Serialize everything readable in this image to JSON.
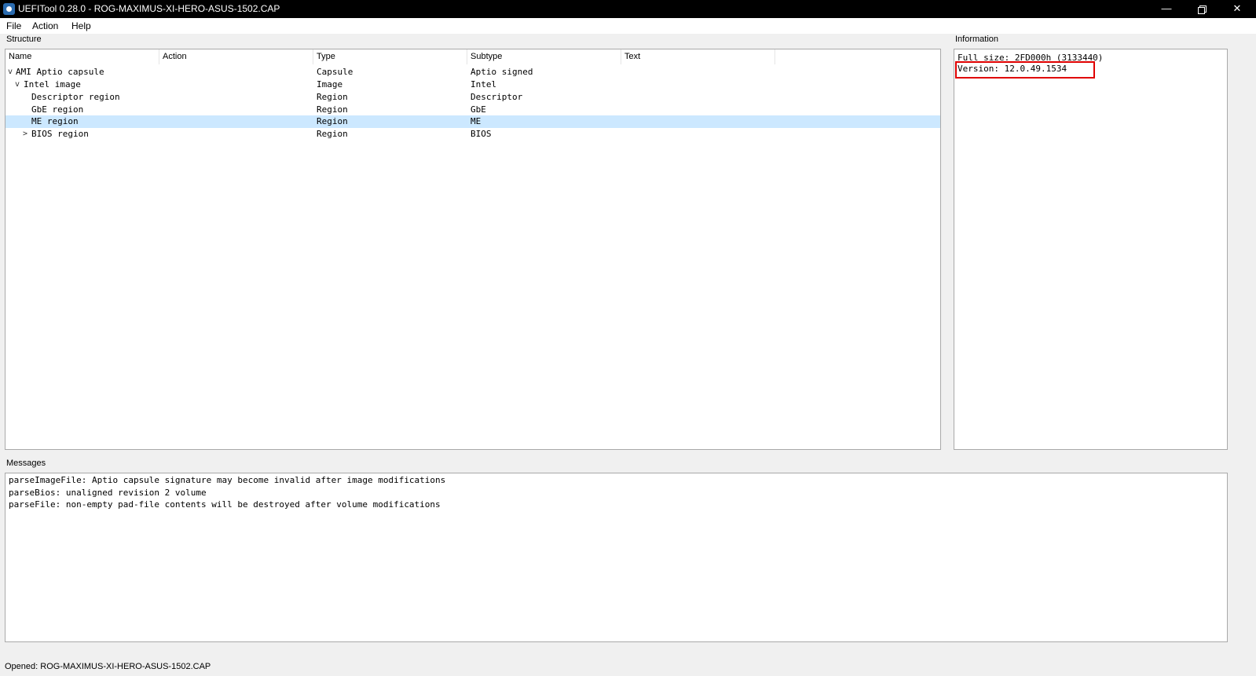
{
  "window": {
    "title": "UEFITool 0.28.0 - ROG-MAXIMUS-XI-HERO-ASUS-1502.CAP",
    "icon": "uefitool-app-icon",
    "buttons": {
      "minimize": "—",
      "close": "✕"
    }
  },
  "menu": {
    "file": "File",
    "action": "Action",
    "help": "Help"
  },
  "structure": {
    "label": "Structure",
    "columns": [
      "Name",
      "Action",
      "Type",
      "Subtype",
      "Text"
    ],
    "rows": [
      {
        "name": "AMI Aptio capsule",
        "action": "",
        "type": "Capsule",
        "subtype": "Aptio signed",
        "text": "",
        "expander": "v"
      },
      {
        "name": "Intel image",
        "action": "",
        "type": "Image",
        "subtype": "Intel",
        "text": "",
        "expander": "v"
      },
      {
        "name": "Descriptor region",
        "action": "",
        "type": "Region",
        "subtype": "Descriptor",
        "text": "",
        "expander": ""
      },
      {
        "name": "GbE region",
        "action": "",
        "type": "Region",
        "subtype": "GbE",
        "text": "",
        "expander": ""
      },
      {
        "name": "ME region",
        "action": "",
        "type": "Region",
        "subtype": "ME",
        "text": "",
        "expander": "",
        "selected": true
      },
      {
        "name": "BIOS region",
        "action": "",
        "type": "Region",
        "subtype": "BIOS",
        "text": "",
        "expander": ">"
      }
    ]
  },
  "information": {
    "label": "Information",
    "lines": [
      "Full size: 2FD000h (3133440)",
      "Version: 12.0.49.1534"
    ],
    "highlight_color": "#e00000"
  },
  "messages": {
    "label": "Messages",
    "lines": [
      "parseImageFile: Aptio capsule signature may become invalid after image modifications",
      "parseBios: unaligned revision 2 volume",
      "parseFile: non-empty pad-file contents will be destroyed after volume modifications"
    ]
  },
  "status": {
    "text": "Opened: ROG-MAXIMUS-XI-HERO-ASUS-1502.CAP"
  },
  "colors": {
    "selection": "#cce8ff",
    "titlebar": "#000000"
  }
}
